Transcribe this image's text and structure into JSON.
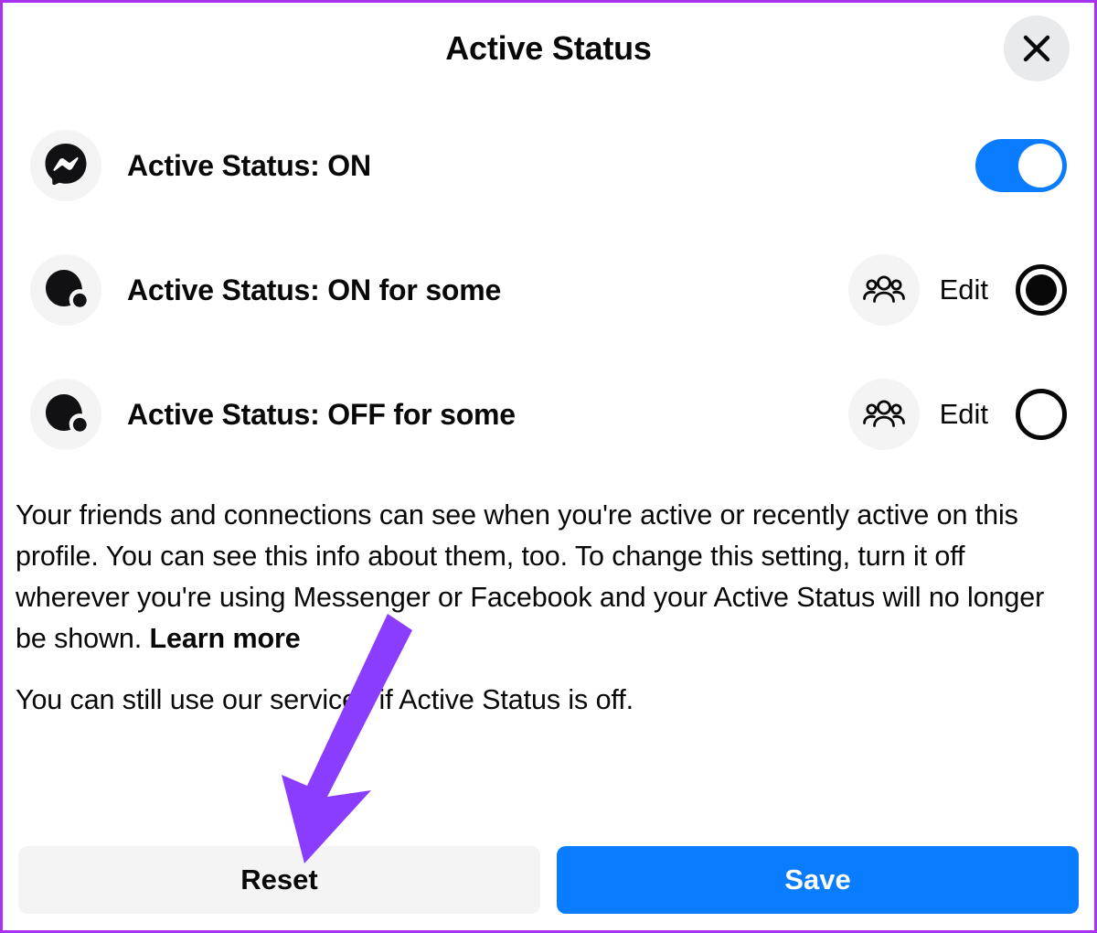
{
  "dialog": {
    "title": "Active Status",
    "close_icon": "close-icon"
  },
  "options": [
    {
      "id": "active-status-on",
      "icon": "messenger-logo-icon",
      "label": "Active Status: ON",
      "control": "toggle",
      "toggle_on": true
    },
    {
      "id": "active-status-on-for-some",
      "icon": "active-status-dot-icon",
      "label": "Active Status: ON for some",
      "control": "radio",
      "selected": true,
      "edit_label": "Edit",
      "edit_icon": "people-group-icon"
    },
    {
      "id": "active-status-off-for-some",
      "icon": "active-status-dot-icon",
      "label": "Active Status: OFF for some",
      "control": "radio",
      "selected": false,
      "edit_label": "Edit",
      "edit_icon": "people-group-icon"
    }
  ],
  "description": {
    "paragraph1_part1": "Your friends and connections can see when you're active or recently active on this profile. You can see this info about them, too. To change this setting, turn it off wherever you're using Messenger or Facebook and your Active Status will no longer be shown. ",
    "learn_more": "Learn more",
    "paragraph2": "You can still use our services if Active Status is off."
  },
  "footer": {
    "reset_label": "Reset",
    "save_label": "Save"
  },
  "annotation": {
    "arrow_color": "#8B3DFF",
    "points_at": "Reset"
  },
  "colors": {
    "accent_blue": "#0a7cff",
    "neutral_bg": "#f4f4f5",
    "close_bg": "#e9eaeb",
    "text": "#080809",
    "frame_border": "#a832f0"
  }
}
